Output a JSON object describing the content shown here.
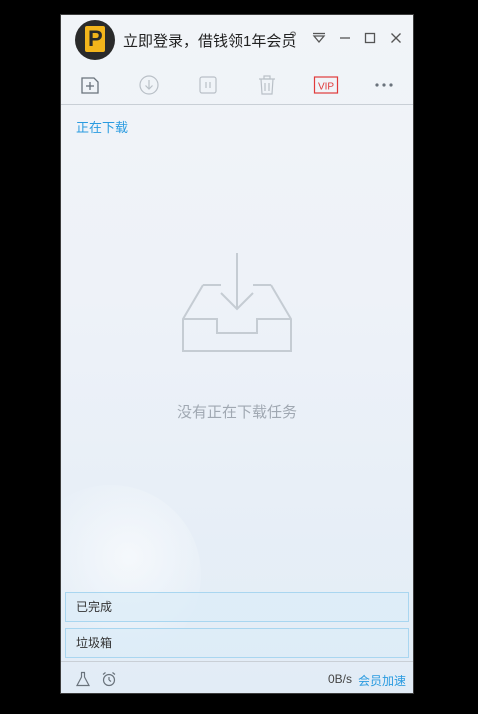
{
  "titlebar": {
    "login_prompt": "立即登录，借钱领1年会员",
    "help_symbol": "?"
  },
  "tabs": {
    "downloading": "正在下载"
  },
  "main": {
    "empty_message": "没有正在下载任务"
  },
  "sections": {
    "completed": "已完成",
    "trash": "垃圾箱"
  },
  "statusbar": {
    "speed": "0B/s",
    "vip_speedup": "会员加速"
  },
  "toolbar": {
    "vip_label": "VIP"
  },
  "colors": {
    "accent": "#2a9be0",
    "vip_red": "#e03a3a",
    "icon_gray": "#8a939c"
  }
}
